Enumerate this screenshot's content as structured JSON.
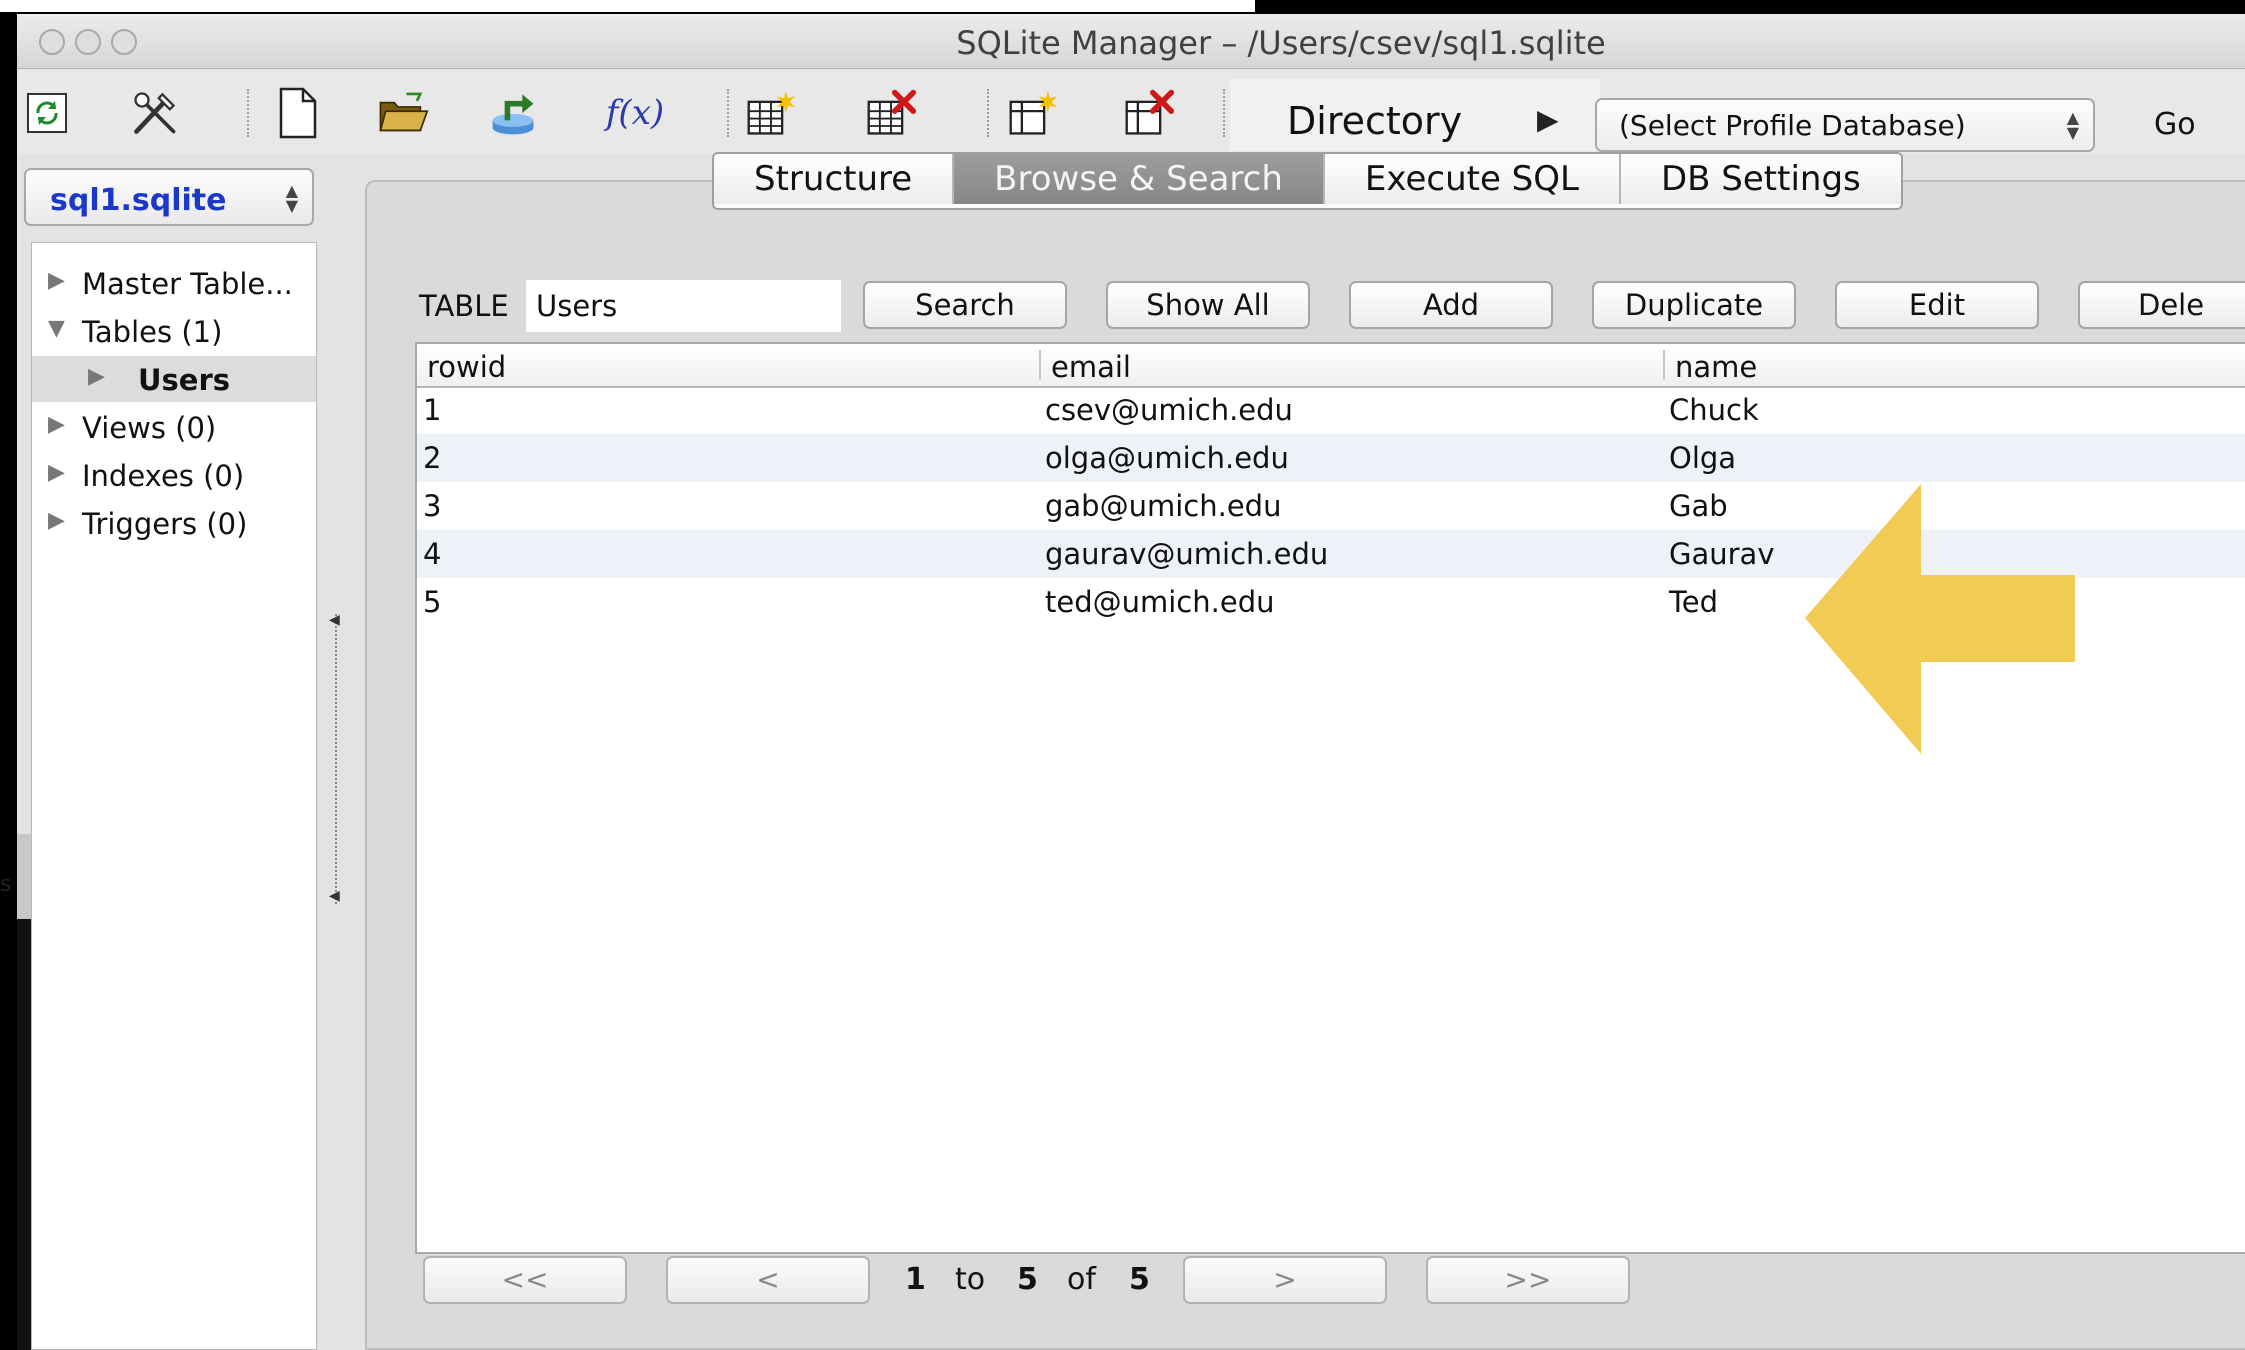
{
  "window": {
    "title": "SQLite Manager – /Users/csev/sql1.sqlite"
  },
  "toolbar": {
    "icons": [
      "refresh-icon",
      "tools-icon",
      "new-db-icon",
      "open-db-icon",
      "export-icon",
      "function-icon",
      "create-table-icon",
      "drop-table-icon",
      "create-index-icon",
      "drop-index-icon"
    ],
    "function_label": "f(x)",
    "directory_label": "Directory",
    "profile_select": "(Select Profile Database)",
    "go_label": "Go"
  },
  "sidebar": {
    "db_select": "sql1.sqlite",
    "tree": [
      {
        "label": "Master Table...",
        "expanded": false
      },
      {
        "label": "Tables (1)",
        "expanded": true
      },
      {
        "label": "Users",
        "expanded": false,
        "child": true,
        "selected": true
      },
      {
        "label": "Views (0)",
        "expanded": false
      },
      {
        "label": "Indexes (0)",
        "expanded": false
      },
      {
        "label": "Triggers (0)",
        "expanded": false
      }
    ]
  },
  "tabs": [
    {
      "label": "Structure",
      "active": false
    },
    {
      "label": "Browse & Search",
      "active": true
    },
    {
      "label": "Execute SQL",
      "active": false
    },
    {
      "label": "DB Settings",
      "active": false
    }
  ],
  "browse": {
    "table_label": "TABLE",
    "table_value": "Users",
    "buttons": [
      "Search",
      "Show All",
      "Add",
      "Duplicate",
      "Edit",
      "Dele"
    ],
    "columns": [
      "rowid",
      "email",
      "name"
    ],
    "rows": [
      [
        "1",
        "csev@umich.edu",
        "Chuck"
      ],
      [
        "2",
        "olga@umich.edu",
        "Olga"
      ],
      [
        "3",
        "gab@umich.edu",
        "Gab"
      ],
      [
        "4",
        "gaurav@umich.edu",
        "Gaurav"
      ],
      [
        "5",
        "ted@umich.edu",
        "Ted"
      ]
    ]
  },
  "pager": {
    "first": "<<",
    "prev": "<",
    "next": ">",
    "last": ">>",
    "from": "1",
    "to_word": "to",
    "to": "5",
    "of_word": "of",
    "total": "5"
  },
  "annotation": {
    "arrow_color": "#f0c84a"
  },
  "colors": {
    "db_select_text": "#1a39c9",
    "active_tab": "#8f8f8f",
    "row_alt": "#eef2f8"
  }
}
